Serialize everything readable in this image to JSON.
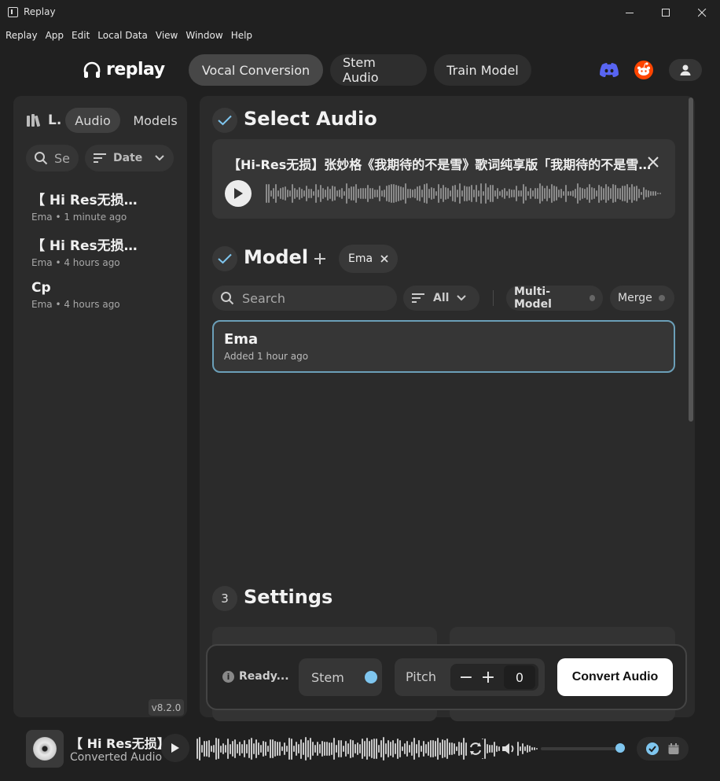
{
  "window": {
    "title": "Replay"
  },
  "menu": [
    "Replay",
    "App",
    "Edit",
    "Local Data",
    "View",
    "Window",
    "Help"
  ],
  "header": {
    "logo": "replay",
    "tabs": [
      {
        "label": "Vocal Conversion",
        "active": true
      },
      {
        "label": "Stem Audio",
        "active": false
      },
      {
        "label": "Train Model",
        "active": false
      }
    ]
  },
  "sidebar": {
    "library_label": "L.",
    "tabs": [
      "Audio",
      "Models"
    ],
    "search_placeholder": "Se",
    "sort_label": "Date",
    "items": [
      {
        "title": "【 Hi Res无损】张妙格",
        "meta": "Ema • 1 minute ago"
      },
      {
        "title": "【 Hi Res无损】张妙格",
        "meta": "Ema • 4 hours ago"
      },
      {
        "title": "Cp",
        "meta": "Ema • 4 hours ago"
      }
    ],
    "version": "v8.2.0"
  },
  "select_audio": {
    "title": "Select Audio",
    "audio_title": "【Hi-Res无损】张妙格《我期待的不是雪》歌词纯享版「我期待的不是雪而是有你的冬天」"
  },
  "model": {
    "title": "Model",
    "selected_chip": "Ema",
    "search_placeholder": "Search",
    "filter_label": "All",
    "multi_model_label": "Multi-Model",
    "merge_label": "Merge",
    "cards": [
      {
        "name": "Ema",
        "added": "Added 1 hour ago"
      }
    ]
  },
  "settings": {
    "step": "3",
    "title": "Settings"
  },
  "action_bar": {
    "status": "Ready...",
    "status_icon": "i",
    "stem_label": "Stem",
    "pitch_label": "Pitch",
    "pitch_minus": "−",
    "pitch_plus": "+",
    "pitch_value": "0",
    "convert_label": "Convert Audio"
  },
  "player": {
    "title": "【 Hi Res无损】张妙格",
    "subtitle": "Converted Audio"
  },
  "colors": {
    "accent": "#7fc6ef",
    "selected_border": "#6b9fb8",
    "discord": "#5865f2",
    "reddit": "#ff4500"
  }
}
